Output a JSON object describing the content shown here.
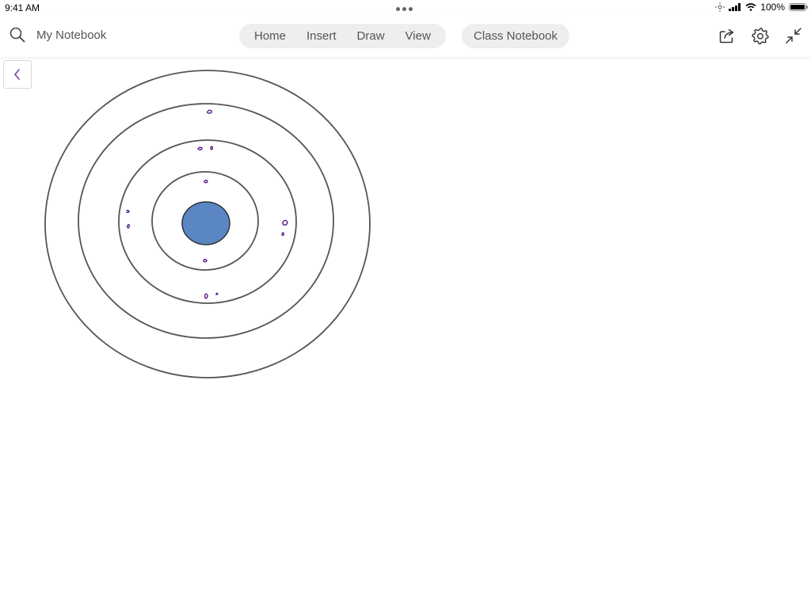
{
  "status_bar": {
    "time": "9:41 AM",
    "battery_percent": "100%",
    "icons": [
      "brightness-icon",
      "signal-icon",
      "wifi-icon",
      "battery-icon"
    ]
  },
  "toolbar": {
    "search_icon": "search-icon",
    "notebook_name": "My Notebook",
    "tabs": [
      "Home",
      "Insert",
      "Draw",
      "View"
    ],
    "class_notebook_label": "Class Notebook",
    "icons": [
      "share-icon",
      "settings-icon",
      "collapse-icon"
    ]
  },
  "navigation": {
    "back_icon": "chevron-left-icon"
  },
  "canvas": {
    "drawing": "concentric-rings-diagram",
    "ink_color": "#5a1f8a",
    "nucleus_color": "#5a87c4",
    "ring_color": "#555555"
  }
}
